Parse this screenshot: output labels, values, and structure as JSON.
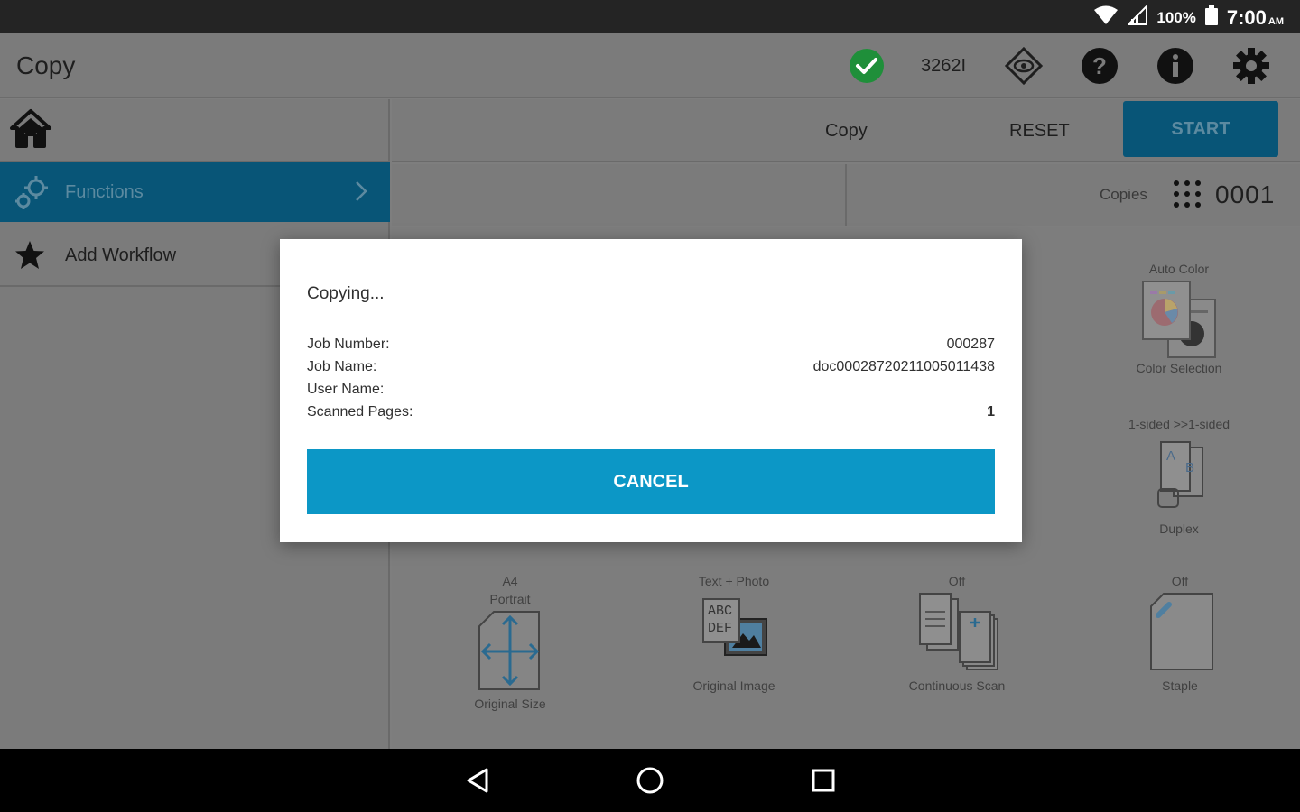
{
  "status_bar": {
    "battery_percent": "100%",
    "time": "7:00",
    "ampm": "AM"
  },
  "app_bar": {
    "title": "Copy",
    "counter": "3262I",
    "icons": [
      "check-circle-icon",
      "eye-diamond-icon",
      "help-icon",
      "info-icon",
      "gear-icon"
    ],
    "colors": {
      "check": "#1f8f3a"
    }
  },
  "sidebar": {
    "items": [
      {
        "label": "Functions",
        "icon": "gears-icon"
      },
      {
        "label": "Add Workflow",
        "icon": "star-icon"
      }
    ]
  },
  "toolbar": {
    "copy_label": "Copy",
    "reset_label": "RESET",
    "start_label": "START"
  },
  "copies": {
    "label": "Copies",
    "value": "0001"
  },
  "functions": {
    "color": {
      "top": "Auto Color",
      "bottom": "Color Selection"
    },
    "duplex": {
      "top": "1-sided >>1-sided",
      "bottom": "Duplex"
    },
    "size": {
      "top1": "A4",
      "top2": "Portrait",
      "bottom": "Original Size"
    },
    "image": {
      "top": "Text + Photo",
      "bottom": "Original Image",
      "glyph_line1": "ABC",
      "glyph_line2": "DEF"
    },
    "continuous": {
      "top": "Off",
      "bottom": "Continuous Scan"
    },
    "staple": {
      "top": "Off",
      "bottom": "Staple"
    }
  },
  "dialog": {
    "title": "Copying...",
    "rows": [
      {
        "label": "Job Number:",
        "value": "000287"
      },
      {
        "label": "Job Name:",
        "value": "doc00028720211005011438"
      },
      {
        "label": "User Name:",
        "value": ""
      },
      {
        "label": "Scanned Pages:",
        "value": "1"
      }
    ],
    "cancel_label": "CANCEL"
  }
}
